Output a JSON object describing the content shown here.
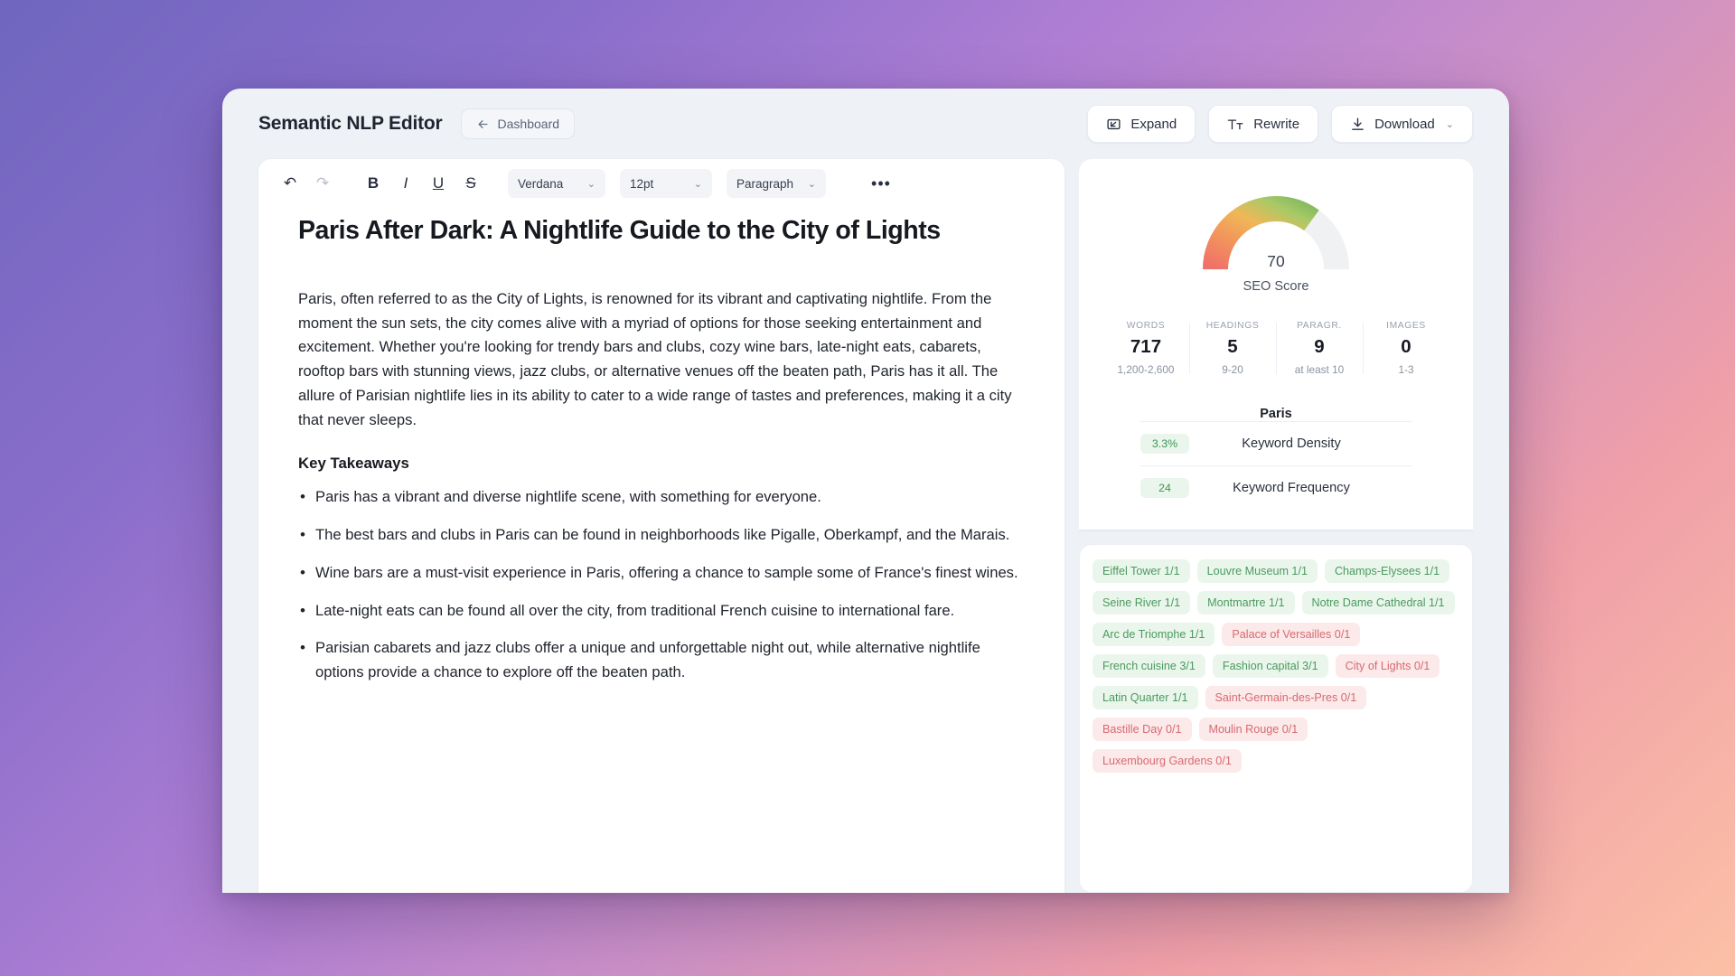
{
  "header": {
    "app_title": "Semantic NLP Editor",
    "dashboard_label": "Dashboard",
    "back_icon": "arrow-left-icon",
    "actions": [
      {
        "label": "Expand",
        "icon": "expand-icon",
        "chevron": ""
      },
      {
        "label": "Rewrite",
        "icon": "text-tt-icon",
        "chevron": ""
      },
      {
        "label": "Download",
        "icon": "download-icon",
        "chevron": "⌄"
      }
    ]
  },
  "toolbar": {
    "undo": "↶",
    "redo": "↷",
    "bold": "B",
    "italic": "I",
    "underline": "U",
    "strikethrough": "S",
    "font_family": "Verdana",
    "font_size": "12pt",
    "block_style": "Paragraph",
    "chevron": "⌄",
    "more": "•••"
  },
  "document": {
    "title": "Paris After Dark: A Nightlife Guide to the City of Lights",
    "paragraphs": [
      "Paris, often referred to as the City of Lights, is renowned for its vibrant and captivating nightlife. From the moment the sun sets, the city comes alive with a myriad of options for those seeking entertainment and excitement. Whether you're looking for trendy bars and clubs, cozy wine bars, late-night eats, cabarets, rooftop bars with stunning views, jazz clubs, or alternative venues off the beaten path, Paris has it all. The allure of Parisian nightlife lies in its ability to cater to a wide range of tastes and preferences, making it a city that never sleeps."
    ],
    "subtitle": "Key Takeaways",
    "bullets": [
      "Paris has a vibrant and diverse nightlife scene, with something for everyone.",
      "The best bars and clubs in Paris can be found in neighborhoods like Pigalle, Oberkampf, and the Marais.",
      "Wine bars are a must-visit experience in Paris, offering a chance to sample some of France's finest wines.",
      "Late-night eats can be found all over the city, from traditional French cuisine to international fare.",
      "Parisian cabarets and jazz clubs offer a unique and unforgettable night out, while alternative nightlife options provide a chance to explore off the beaten path."
    ]
  },
  "seo": {
    "score": "70",
    "score_value": 70,
    "score_label": "SEO Score",
    "gauge_colors": [
      "#f0706a",
      "#f0a050",
      "#f5c45a",
      "#8cc163",
      "#6bb158"
    ],
    "gauge_track_color": "#f0f1f3",
    "stats": [
      {
        "label": "Words",
        "value": "717",
        "range": "1,200-2,600"
      },
      {
        "label": "Headings",
        "value": "5",
        "range": "9-20"
      },
      {
        "label": "Paragr.",
        "value": "9",
        "range": "at least 10"
      },
      {
        "label": "Images",
        "value": "0",
        "range": "1-3"
      }
    ],
    "keyword_title": "Paris",
    "keyword_rows": [
      {
        "badge": "3.3%",
        "name": "Keyword Density"
      },
      {
        "badge": "24",
        "name": "Keyword Frequency"
      }
    ],
    "accent_ok": "#4a9a5f",
    "accent_miss": "#d76a72"
  },
  "tags": [
    {
      "label": "Eiffel Tower 1/1",
      "state": "ok"
    },
    {
      "label": "Louvre Museum 1/1",
      "state": "ok"
    },
    {
      "label": "Champs-Elysees 1/1",
      "state": "ok"
    },
    {
      "label": "Seine River 1/1",
      "state": "ok"
    },
    {
      "label": "Montmartre 1/1",
      "state": "ok"
    },
    {
      "label": "Notre Dame Cathedral 1/1",
      "state": "ok"
    },
    {
      "label": "Arc de Triomphe 1/1",
      "state": "ok"
    },
    {
      "label": "Palace of Versailles 0/1",
      "state": "miss"
    },
    {
      "label": "French cuisine 3/1",
      "state": "ok"
    },
    {
      "label": "Fashion capital 3/1",
      "state": "ok"
    },
    {
      "label": "City of Lights 0/1",
      "state": "miss"
    },
    {
      "label": "Latin Quarter 1/1",
      "state": "ok"
    },
    {
      "label": "Saint-Germain-des-Pres 0/1",
      "state": "miss"
    },
    {
      "label": "Bastille Day 0/1",
      "state": "miss"
    },
    {
      "label": "Moulin Rouge 0/1",
      "state": "miss"
    },
    {
      "label": "Luxembourg Gardens 0/1",
      "state": "miss"
    }
  ]
}
